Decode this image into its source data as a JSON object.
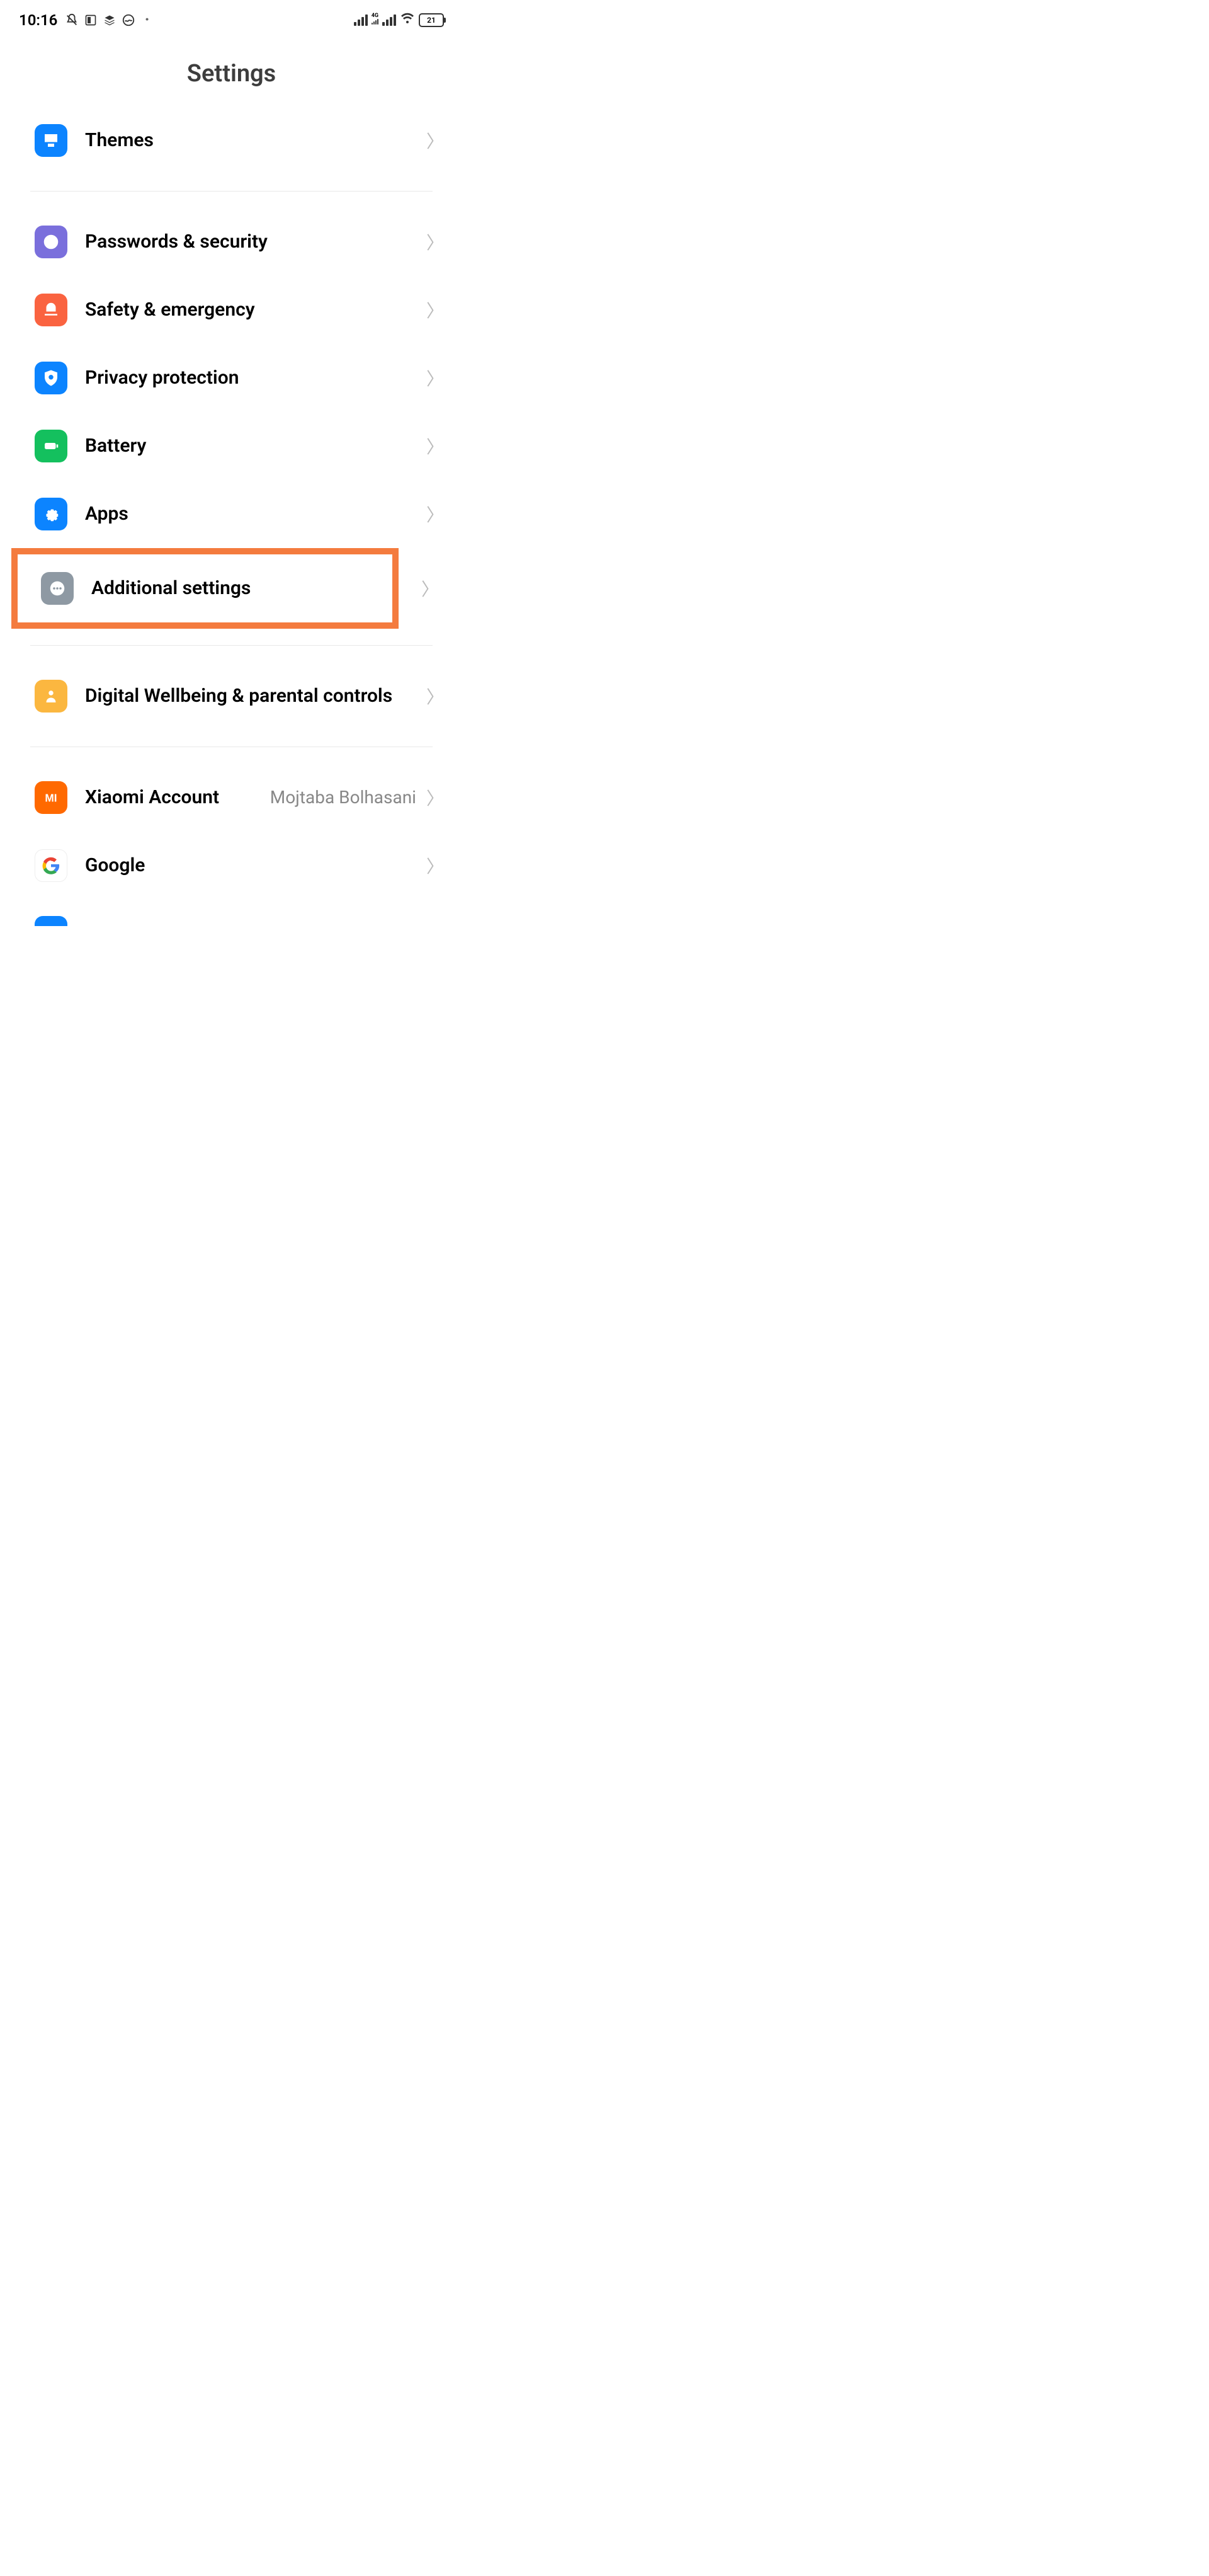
{
  "status_bar": {
    "time": "10:16",
    "network_label": "4G",
    "battery": "21"
  },
  "page_title": "Settings",
  "items": {
    "themes": "Themes",
    "passwords": "Passwords & security",
    "safety": "Safety & emergency",
    "privacy": "Privacy protection",
    "battery": "Battery",
    "apps": "Apps",
    "additional": "Additional settings",
    "wellbeing": "Digital Wellbeing & parental controls",
    "xiaomi": "Xiaomi Account",
    "xiaomi_value": "Mojtaba Bolhasani",
    "google": "Google"
  }
}
